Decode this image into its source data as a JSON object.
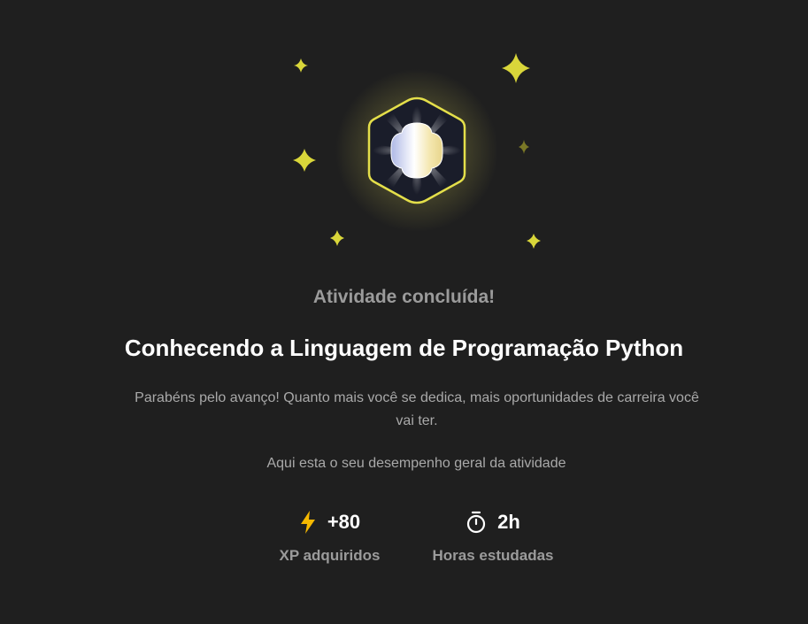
{
  "completion": {
    "heading": "Atividade concluída!",
    "activity_title": "Conhecendo a Linguagem de Programação Python",
    "message": "Parabéns pelo avanço! Quanto mais você se dedica, mais oportunidades de carreira você vai ter.",
    "performance_text": "Aqui esta o seu desempenho geral da atividade"
  },
  "stats": {
    "xp": {
      "value": "+80",
      "label": "XP adquiridos",
      "icon": "lightning-icon"
    },
    "hours": {
      "value": "2h",
      "label": "Horas estudadas",
      "icon": "stopwatch-icon"
    }
  },
  "badge": {
    "icon": "achievement-badge-icon",
    "decoration": "sparkle-icons"
  },
  "colors": {
    "background": "#1f1f1f",
    "accent_yellow": "#d9d63a",
    "xp_icon": "#f5b800",
    "text_primary": "#ffffff",
    "text_secondary": "#a9a9a9"
  }
}
